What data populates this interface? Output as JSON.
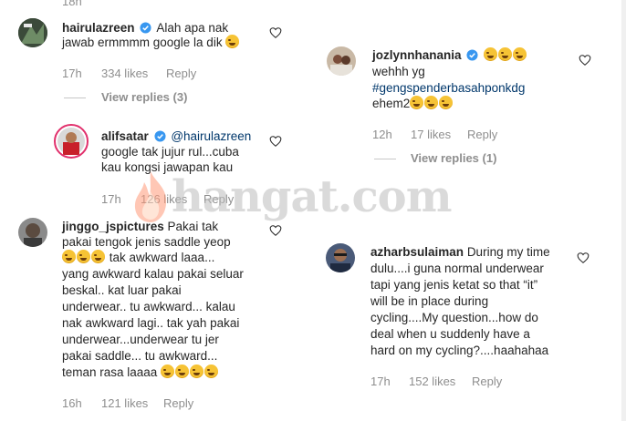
{
  "top_time": "18h",
  "left": {
    "c1": {
      "username": "hairulazreen",
      "text": "Alah apa nak",
      "line2": "jawab ermmmm google la dik",
      "time": "17h",
      "likes": "334 likes",
      "reply": "Reply",
      "view_replies": "View replies (3)"
    },
    "c2": {
      "username": "alifsatar",
      "mention": "@hairulazreen",
      "line2": "google tak jujur rul...cuba",
      "line3": "kau kongsi jawapan kau",
      "time": "17h",
      "likes": "126 likes",
      "reply": "Reply"
    },
    "c3": {
      "username": "jinggo_jspictures",
      "line1_rest": "Pakai tak",
      "line2": "pakai tengok jenis saddle yeop",
      "line3_rest": "tak awkward laaa...",
      "line4": "yang awkward kalau pakai seluar",
      "line5": "beskal.. kat luar pakai",
      "line6": "underwear.. tu awkward... kalau",
      "line7": "nak awkward lagi.. tak yah pakai",
      "line8": "underwear...underwear tu jer",
      "line9": "pakai saddle... tu awkward...",
      "line10": "teman rasa laaaa",
      "time": "16h",
      "likes": "121 likes",
      "reply": "Reply"
    }
  },
  "right": {
    "c1": {
      "username": "jozlynnhanania",
      "line2": "wehhh yg",
      "line3": "#gengspenderbasahponkdg",
      "line4": "ehem2",
      "time": "12h",
      "likes": "17 likes",
      "reply": "Reply",
      "view_replies": "View replies (1)"
    },
    "c2": {
      "username": "azharbsulaiman",
      "line1_rest": "During my time",
      "line2": "dulu....i guna normal underwear",
      "line3": "tapi yang jenis ketat so that “it”",
      "line4": "will be in place during",
      "line5": "cycling....My question...how do",
      "line6": "deal when u suddenly have a",
      "line7": "hard on my cycling?....haahahaa",
      "time": "17h",
      "likes": "152 likes",
      "reply": "Reply"
    }
  },
  "watermark": "hangat.com",
  "colors": {
    "verified": "#3897f0",
    "link": "#00376b",
    "muted": "#8e8e8e"
  }
}
